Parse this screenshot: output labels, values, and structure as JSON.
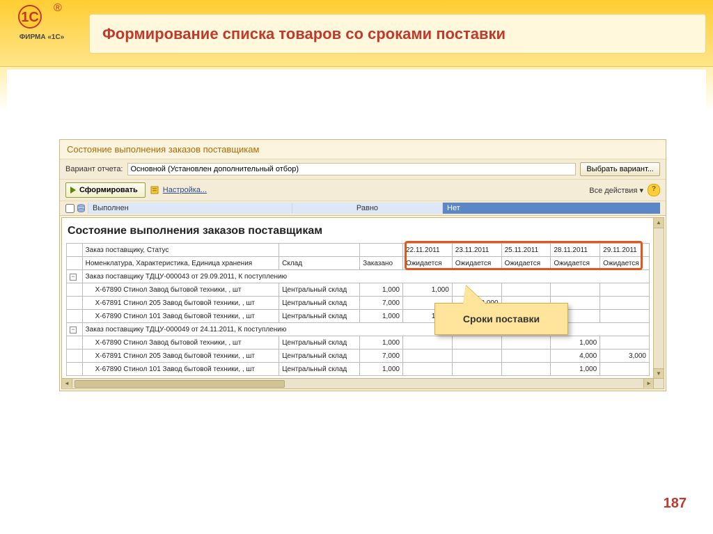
{
  "logo_sub": "ФИРМА «1С»",
  "banner_title": "Формирование списка товаров со сроками поставки",
  "page_number": "187",
  "app": {
    "title": "Состояние выполнения заказов поставщикам",
    "variant_label": "Вариант отчета:",
    "variant_value": "Основной (Установлен дополнительный отбор)",
    "choose_variant": "Выбрать вариант...",
    "form_btn": "Сформировать",
    "settings_link": "Настройка...",
    "all_actions": "Все действия ▾",
    "filter_field": "Выполнен",
    "filter_op": "Равно",
    "filter_val": "Нет",
    "report_title": "Состояние выполнения заказов поставщикам",
    "h_order": "Заказ поставщику, Статус",
    "h_nomen": "Номенклатура, Характеристика, Единица хранения",
    "h_sklad": "Склад",
    "h_zakaz": "Заказано",
    "dates": [
      "22.11.2011",
      "23.11.2011",
      "25.11.2011",
      "28.11.2011",
      "29.11.2011"
    ],
    "expected": "Ожидается",
    "groups": [
      {
        "title": "Заказ поставщику ТДЦУ-000043 от 29.09.2011, К поступлению",
        "rows": [
          {
            "n": "Х-67890 Стинол Завод бытовой техники, , шт",
            "s": "Центральный склад",
            "z": "1,000",
            "c": [
              "1,000",
              "",
              "",
              "",
              ""
            ]
          },
          {
            "n": "Х-67891 Стинол 205 Завод бытовой техники, , шт",
            "s": "Центральный склад",
            "z": "7,000",
            "c": [
              "",
              "3,000",
              "",
              "",
              ""
            ]
          },
          {
            "n": "Х-67890 Стинол 101 Завод бытовой техники, , шт",
            "s": "Центральный склад",
            "z": "1,000",
            "c": [
              "1,000",
              "",
              "",
              "",
              ""
            ]
          }
        ]
      },
      {
        "title": "Заказ поставщику ТДЦУ-000049 от 24.11.2011, К поступлению",
        "rows": [
          {
            "n": "Х-67890 Стинол Завод бытовой техники, , шт",
            "s": "Центральный склад",
            "z": "1,000",
            "c": [
              "",
              "",
              "",
              "1,000",
              ""
            ]
          },
          {
            "n": "Х-67891 Стинол 205 Завод бытовой техники, , шт",
            "s": "Центральный склад",
            "z": "7,000",
            "c": [
              "",
              "",
              "",
              "4,000",
              "3,000"
            ]
          },
          {
            "n": "Х-67890 Стинол 101 Завод бытовой техники, , шт",
            "s": "Центральный склад",
            "z": "1,000",
            "c": [
              "",
              "",
              "",
              "1,000",
              ""
            ]
          }
        ]
      }
    ],
    "callout": "Сроки поставки"
  }
}
